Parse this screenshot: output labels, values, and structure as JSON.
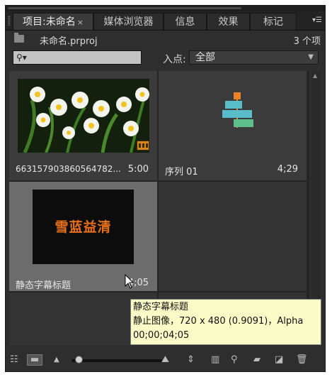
{
  "tabs": [
    {
      "label": "项目:未命名",
      "close": "×",
      "active": true
    },
    {
      "label": "媒体浏览器",
      "active": false
    },
    {
      "label": "信息",
      "active": false
    },
    {
      "label": "效果",
      "active": false
    },
    {
      "label": "标记",
      "active": false
    }
  ],
  "tab_menu_icon": "panel-menu-icon",
  "project": {
    "name": "未命名.prproj",
    "item_count": "3 个项"
  },
  "search": {
    "icon": "magnifier-icon",
    "value": ""
  },
  "in_point": {
    "label": "入点:",
    "value": "全部"
  },
  "clips": [
    {
      "name": "663157903860564782...",
      "duration": "5:00",
      "kind": "video-clip",
      "thumbnail": "white daffodil flowers"
    },
    {
      "name": "序列 01",
      "duration": "4;29",
      "kind": "sequence"
    },
    {
      "name": "静态字幕标题",
      "duration": "4;05",
      "kind": "title",
      "title_text": "雪蓝益清"
    }
  ],
  "tooltip": {
    "line1": "静态字幕标题",
    "line2": "静止图像，720 x 480 (0.9091)，Alpha",
    "line3": "00;00;04;05"
  },
  "toolbar_icons": [
    "list-view-icon",
    "icon-view-icon",
    "zoom-out-icon",
    "zoom-in-icon",
    "sort-icon",
    "automate-to-sequence-icon",
    "find-icon",
    "new-bin-icon",
    "new-item-icon",
    "delete-icon"
  ],
  "colors": {
    "panel_bg": "#2e2e2e",
    "tooltip_bg": "#fbfbc8",
    "badge": "#d9861a",
    "title_text": "#e8701c"
  }
}
